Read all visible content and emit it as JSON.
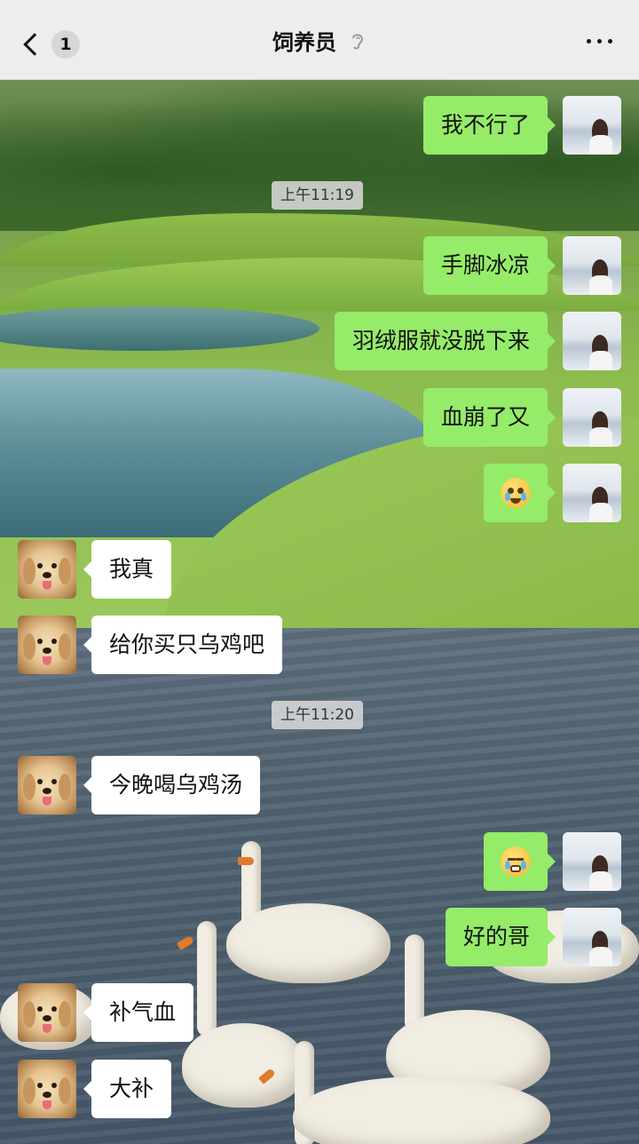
{
  "header": {
    "unread_count": "1",
    "title": "饲养员",
    "icons": {
      "back": "chevron-left-icon",
      "mute": "ear-mute-icon",
      "more": "more-dots-icon"
    }
  },
  "colors": {
    "my_bubble": "#95ec69",
    "their_bubble": "#ffffff",
    "header_bg": "#ededed"
  },
  "messages": [
    {
      "from": "me",
      "type": "text",
      "text": "我不行了"
    },
    {
      "type": "time",
      "text": "上午11:19"
    },
    {
      "from": "me",
      "type": "text",
      "text": "手脚冰凉"
    },
    {
      "from": "me",
      "type": "text",
      "text": "羽绒服就没脱下来"
    },
    {
      "from": "me",
      "type": "text",
      "text": "血崩了又"
    },
    {
      "from": "me",
      "type": "emoji",
      "emoji": "crying-face"
    },
    {
      "from": "them",
      "type": "text",
      "text": "我真"
    },
    {
      "from": "them",
      "type": "text",
      "text": "给你买只乌鸡吧"
    },
    {
      "type": "time",
      "text": "上午11:20"
    },
    {
      "from": "them",
      "type": "text",
      "text": "今晚喝乌鸡汤"
    },
    {
      "from": "me",
      "type": "emoji",
      "emoji": "grimacing-tears-face"
    },
    {
      "from": "me",
      "type": "text",
      "text": "好的哥"
    },
    {
      "from": "them",
      "type": "text",
      "text": "补气血"
    },
    {
      "from": "them",
      "type": "text",
      "text": "大补"
    }
  ]
}
